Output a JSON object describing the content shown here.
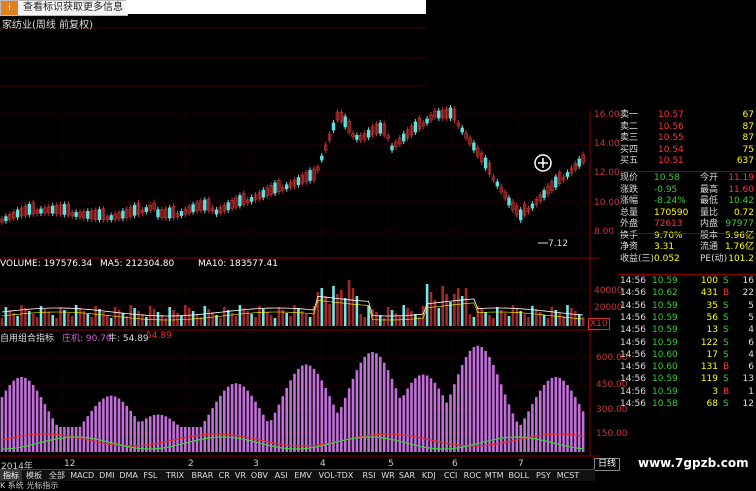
{
  "hint": {
    "text": "查看标识获取更多信息",
    "icon": "hint-icon"
  },
  "title": "家纺业(周线 前复权)",
  "volume_info": {
    "volume": "VOLUME: 197576.34",
    "ma5": "MA5: 212304.80",
    "ma10": "MA10: 183577.41"
  },
  "indicator_info": {
    "name": "自用组合指标",
    "label1": "庄机: 90.70",
    "label2": "牛: 54.89",
    "label3": "54.89"
  },
  "price_axis": [
    "16.00",
    "14.00",
    "12.00",
    "10.00",
    "8.00"
  ],
  "volume_axis": [
    "40000",
    "20000",
    "X10"
  ],
  "indicator_axis": [
    "600.00",
    "450.00",
    "300.00",
    "150.00"
  ],
  "low_marker": "7.12",
  "orderbook": [
    {
      "label": "卖一",
      "price": "10.57",
      "vol": "67"
    },
    {
      "label": "卖二",
      "price": "10.56",
      "vol": "87"
    },
    {
      "label": "卖三",
      "price": "10.55",
      "vol": "87"
    },
    {
      "label": "买四",
      "price": "10.54",
      "vol": "75"
    },
    {
      "label": "买五",
      "price": "10.51",
      "vol": "637"
    }
  ],
  "stats": [
    {
      "l1": "现价",
      "v1": "10.58",
      "l2": "今开",
      "v2": "11.19"
    },
    {
      "l1": "涨跌",
      "v1": "-0.95",
      "l2": "最高",
      "v2": "11.60"
    },
    {
      "l1": "涨幅",
      "v1": "-8.24%",
      "l2": "最低",
      "v2": "10.42"
    },
    {
      "l1": "总量",
      "v1": "170590",
      "l2": "量比",
      "v2": "0.72"
    },
    {
      "l1": "外盘",
      "v1": "72613",
      "l2": "内盘",
      "v2": "97977"
    },
    {
      "l1": "换手",
      "v1": "9.70%",
      "l2": "股本",
      "v2": "5.96亿"
    },
    {
      "l1": "净资",
      "v1": "3.31",
      "l2": "流通",
      "v2": "1.76亿"
    },
    {
      "l1": "收益(三)",
      "v1": "0.052",
      "l2": "PE(动)",
      "v2": "101.2"
    }
  ],
  "trades": [
    {
      "time": "14:56",
      "price": "10.59",
      "vol": "100",
      "side": "S",
      "num": "16"
    },
    {
      "time": "14:56",
      "price": "10.62",
      "vol": "431",
      "side": "B",
      "num": "22"
    },
    {
      "time": "14:56",
      "price": "10.59",
      "vol": "35",
      "side": "S",
      "num": "5"
    },
    {
      "time": "14:56",
      "price": "10.59",
      "vol": "56",
      "side": "S",
      "num": "5"
    },
    {
      "time": "14:56",
      "price": "10.59",
      "vol": "13",
      "side": "S",
      "num": "4"
    },
    {
      "time": "14:56",
      "price": "10.59",
      "vol": "122",
      "side": "S",
      "num": "6"
    },
    {
      "time": "14:56",
      "price": "10.60",
      "vol": "17",
      "side": "S",
      "num": "4"
    },
    {
      "time": "14:56",
      "price": "10.60",
      "vol": "131",
      "side": "B",
      "num": "6"
    },
    {
      "time": "14:56",
      "price": "10.59",
      "vol": "119",
      "side": "S",
      "num": "13"
    },
    {
      "time": "14:56",
      "price": "10.59",
      "vol": "3",
      "side": "B",
      "num": "1"
    },
    {
      "time": "14:56",
      "price": "10.58",
      "vol": "68",
      "side": "S",
      "num": "12"
    }
  ],
  "x_labels": [
    "2014年",
    "12",
    "2",
    "3",
    "4",
    "5",
    "6",
    "7"
  ],
  "tabs": [
    "指标",
    "模板",
    "全部",
    "MACD",
    "DMI",
    "DMA",
    "FSL",
    "TRIX",
    "BRAR",
    "CR",
    "VR",
    "OBV",
    "ASI",
    "EMV",
    "VOL-TDX",
    "RSI",
    "WR",
    "SAR",
    "KDJ",
    "CCI",
    "ROC",
    "MTM",
    "BOLL",
    "PSY",
    "MCST"
  ],
  "active_tab": "指标",
  "period": "日线",
  "watermark": "www.7gpzb.com",
  "bottom_text": "K 系统  光标指示"
}
